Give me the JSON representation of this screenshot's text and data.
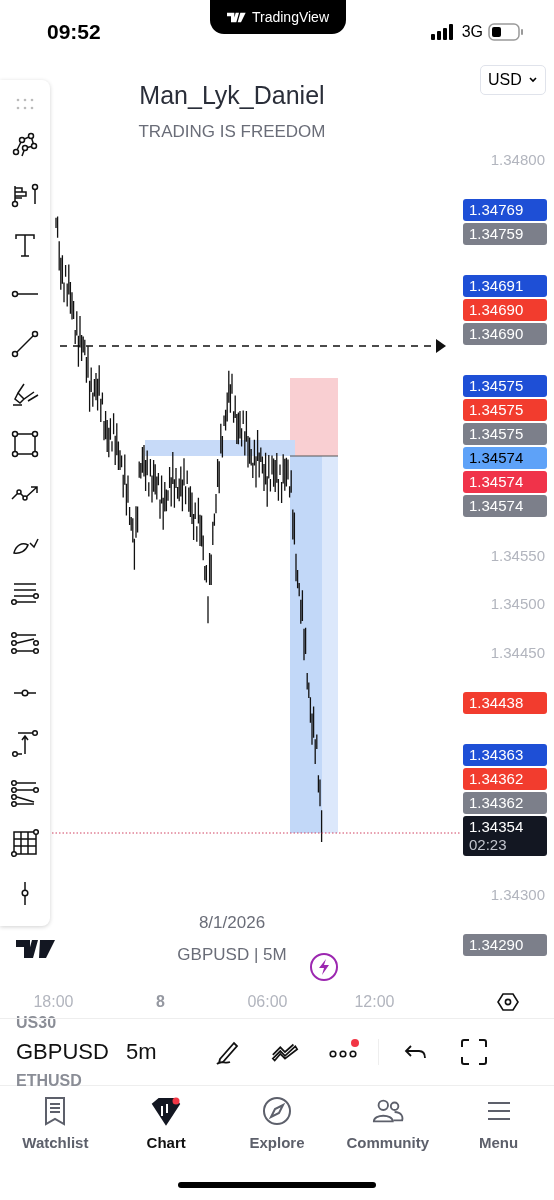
{
  "status_bar": {
    "time": "09:52",
    "app_banner": "TradingView",
    "network": "3G"
  },
  "header": {
    "title": "Man_Lyk_Daniel",
    "subtitle": "TRADING IS FREEDOM",
    "currency": "USD"
  },
  "drawing_tools": [
    {
      "kind": "drag"
    },
    {
      "kind": "pattern"
    },
    {
      "kind": "gann"
    },
    {
      "kind": "text"
    },
    {
      "kind": "ray"
    },
    {
      "kind": "trendline"
    },
    {
      "kind": "highlighter"
    },
    {
      "kind": "rectangle"
    },
    {
      "kind": "path"
    },
    {
      "kind": "brush"
    },
    {
      "kind": "channel"
    },
    {
      "kind": "regression"
    },
    {
      "kind": "hline"
    },
    {
      "kind": "measure"
    },
    {
      "kind": "projection"
    },
    {
      "kind": "grid"
    },
    {
      "kind": "vline"
    }
  ],
  "price_axis": [
    {
      "kind": "tick",
      "text": "1.34800"
    },
    {
      "kind": "group",
      "tags": [
        {
          "text": "1.34769",
          "color": "#1e4fd6"
        },
        {
          "text": "1.34759",
          "color": "#7c7f8a"
        }
      ]
    },
    {
      "kind": "group",
      "tags": [
        {
          "text": "1.34691",
          "color": "#1e4fd6"
        },
        {
          "text": "1.34690",
          "color": "#f23c2e"
        },
        {
          "text": "1.34690",
          "color": "#7c7f8a"
        }
      ]
    },
    {
      "kind": "group",
      "tags": [
        {
          "text": "1.34575",
          "color": "#1e4fd6"
        },
        {
          "text": "1.34575",
          "color": "#f23c2e"
        },
        {
          "text": "1.34575",
          "color": "#7c7f8a"
        },
        {
          "text": "1.34574",
          "color": "#5ea2f8"
        },
        {
          "text": "1.34574",
          "color": "#f0334a"
        },
        {
          "text": "1.34574",
          "color": "#7c7f8a"
        }
      ]
    },
    {
      "kind": "tick",
      "text": "1.34550"
    },
    {
      "kind": "tick",
      "text": "1.34500"
    },
    {
      "kind": "tick",
      "text": "1.34450"
    },
    {
      "kind": "group",
      "tags": [
        {
          "text": "1.34438",
          "color": "#f23c2e"
        }
      ]
    },
    {
      "kind": "group",
      "tags": [
        {
          "text": "1.34363",
          "color": "#1e4fd6"
        },
        {
          "text": "1.34362",
          "color": "#f23c2e"
        },
        {
          "text": "1.34362",
          "color": "#7c7f8a"
        },
        {
          "text": "1.34354",
          "color": "#131722",
          "countdown": "02:23"
        }
      ]
    },
    {
      "kind": "tick",
      "text": "1.34300"
    },
    {
      "kind": "group",
      "tags": [
        {
          "text": "1.34290",
          "color": "#7c7f8a"
        }
      ]
    }
  ],
  "chart_info": {
    "date": "8/1/2026",
    "symbol": "GBPUSD | 5M"
  },
  "time_axis": [
    {
      "label": "18:00",
      "bold": false
    },
    {
      "label": "8",
      "bold": true
    },
    {
      "label": "06:00",
      "bold": false
    },
    {
      "label": "12:00",
      "bold": false
    }
  ],
  "symbol_bar": {
    "symbols": [
      {
        "name": "US30",
        "selected": false
      },
      {
        "name": "GBPUSD",
        "selected": true
      },
      {
        "name": "ETHUSD",
        "selected": false
      }
    ],
    "interval": "5m",
    "more_has_notification": true
  },
  "tabs": [
    {
      "label": "Watchlist",
      "kind": "watchlist",
      "selected": false
    },
    {
      "label": "Chart",
      "kind": "chart",
      "selected": true
    },
    {
      "label": "Explore",
      "kind": "explore",
      "selected": false
    },
    {
      "label": "Community",
      "kind": "community",
      "selected": false
    },
    {
      "label": "Menu",
      "kind": "menu",
      "selected": false
    }
  ]
}
